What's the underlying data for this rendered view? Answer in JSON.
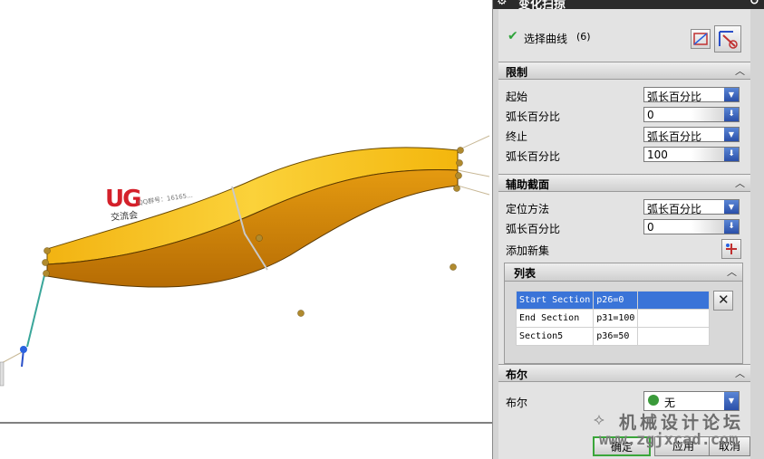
{
  "window": {
    "title": "变化扫掠"
  },
  "viewport": {
    "logo_text": "UG",
    "logo_sub": "交流会",
    "logo_sub2": "QQ群号：16165..."
  },
  "selection": {
    "label": "选择曲线",
    "count": "(6)"
  },
  "limits": {
    "header": "限制",
    "start_label": "起始",
    "start_value": "弧长百分比",
    "start_pct_label": "弧长百分比",
    "start_pct_value": "0",
    "end_label": "终止",
    "end_value": "弧长百分比",
    "end_pct_label": "弧长百分比",
    "end_pct_value": "100"
  },
  "aux_section": {
    "header": "辅助截面",
    "locate_label": "定位方法",
    "locate_value": "弧长百分比",
    "pct_label": "弧长百分比",
    "pct_value": "0",
    "add_set_label": "添加新集"
  },
  "list": {
    "header": "列表",
    "rows": [
      {
        "name": "Start Section",
        "param": "p26=0"
      },
      {
        "name": "End Section",
        "param": "p31=100"
      },
      {
        "name": "Section5",
        "param": "p36=50"
      }
    ]
  },
  "boolean": {
    "header": "布尔",
    "label": "布尔",
    "value": "无"
  },
  "buttons": {
    "ok": "确定",
    "apply": "应用",
    "cancel": "取消"
  },
  "watermark": {
    "line1": "机械设计论坛",
    "line2": "www.zgjxcad.com"
  },
  "colors": {
    "surface_top": "#f6c21a",
    "surface_side": "#d4860a",
    "selection_blue": "#3a74d8",
    "check_green": "#2ea33a"
  }
}
